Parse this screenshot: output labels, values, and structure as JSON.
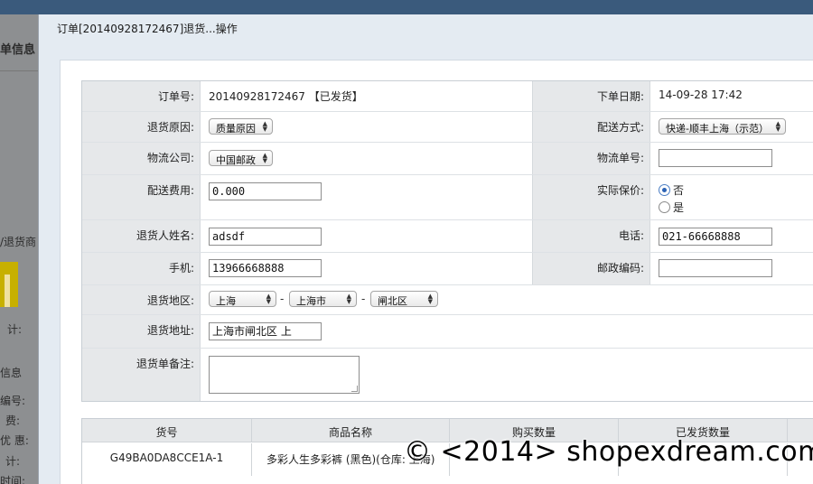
{
  "background": {
    "section_order": "单信息",
    "section_return_goods": "/退货商",
    "total_label": "计:",
    "section_info": "信息",
    "number_label": "编号:",
    "fee_label": "费:",
    "discount_label": "优 惠:",
    "total_label2": "计:",
    "time_label": "时间:"
  },
  "dialog": {
    "title": "订单[20140928172467]退货...操作"
  },
  "form": {
    "order_no_label": "订单号:",
    "order_no_value": "20140928172467 【已发货】",
    "order_date_label": "下单日期:",
    "order_date_value": "14-09-28 17:42",
    "return_reason_label": "退货原因:",
    "return_reason_value": "质量原因",
    "delivery_method_label": "配送方式:",
    "delivery_method_value": "快递-顺丰上海（示范）",
    "logistics_label": "物流公司:",
    "logistics_value": "中国邮政",
    "tracking_no_label": "物流单号:",
    "tracking_no_value": "",
    "shipping_fee_label": "配送费用:",
    "shipping_fee_value": "0.000",
    "insured_label": "实际保价:",
    "insured_no": "否",
    "insured_yes": "是",
    "name_label": "退货人姓名:",
    "name_value": "adsdf",
    "phone_label": "电话:",
    "phone_value": "021-66668888",
    "mobile_label": "手机:",
    "mobile_value": "13966668888",
    "zip_label": "邮政编码:",
    "zip_value": "",
    "region_label": "退货地区:",
    "province": "上海",
    "city": "上海市",
    "district": "闸北区",
    "region_sep": "-",
    "address_label": "退货地址:",
    "address_value": "上海市闸北区        上",
    "remark_label": "退货单备注:",
    "remark_value": ""
  },
  "goods_table": {
    "headers": [
      "货号",
      "商品名称",
      "购买数量",
      "已发货数量"
    ],
    "rows": [
      [
        "G49BA0DA8CCE1A-1",
        "多彩人生多彩裤 (黑色)(仓库: 上海)",
        "",
        ""
      ]
    ]
  },
  "watermark": "© <2014> shopexdream.com"
}
